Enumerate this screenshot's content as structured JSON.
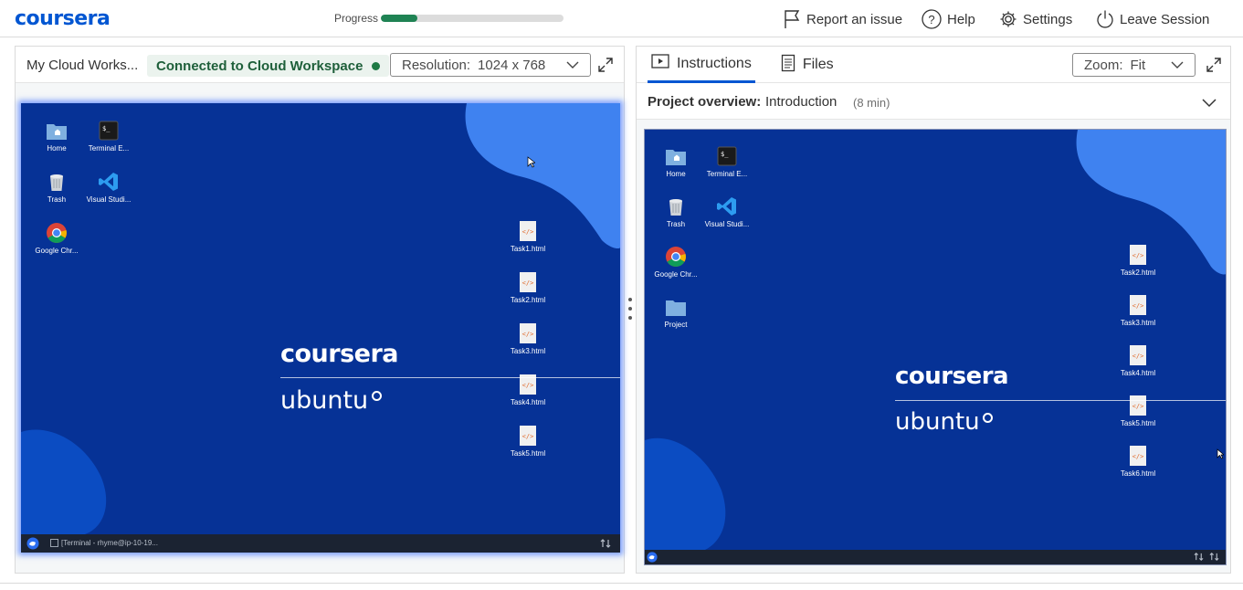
{
  "header": {
    "logo": "coursera",
    "progress_label": "Progress",
    "progress_value": 0.2,
    "actions": {
      "report": "Report an issue",
      "help": "Help",
      "settings": "Settings",
      "leave": "Leave Session"
    }
  },
  "workspace": {
    "title": "My Cloud Works...",
    "status": "Connected to Cloud Workspace",
    "resolution_label": "Resolution:",
    "resolution_value": "1024 x 768",
    "desktop_icons": [
      "Home",
      "Terminal E...",
      "Trash",
      "Visual Studi...",
      "Google Chr..."
    ],
    "files": [
      "Task1.html",
      "Task2.html",
      "Task3.html",
      "Task4.html",
      "Task5.html"
    ],
    "brand_top": "coursera",
    "brand_bottom": "ubuntu",
    "taskbar_item": "[Terminal - rhyme@ip-10-19..."
  },
  "instructions": {
    "tabs": [
      "Instructions",
      "Files"
    ],
    "zoom_label": "Zoom:",
    "zoom_value": "Fit",
    "overview_label": "Project overview:",
    "overview_title": "Introduction",
    "overview_duration": "(8 min)",
    "desktop_icons": [
      "Home",
      "Terminal E...",
      "Trash",
      "Visual Studi...",
      "Google Chr...",
      "Project"
    ],
    "files": [
      "Task2.html",
      "Task3.html",
      "Task4.html",
      "Task5.html",
      "Task6.html"
    ],
    "brand_top": "coursera",
    "brand_bottom": "ubuntu"
  },
  "colors": {
    "brand_blue": "#0056d2",
    "progress_green": "#1f8354",
    "desktop_bg": "#063296",
    "desktop_blob": "#3f82f0",
    "status_green": "#1e7a44"
  }
}
